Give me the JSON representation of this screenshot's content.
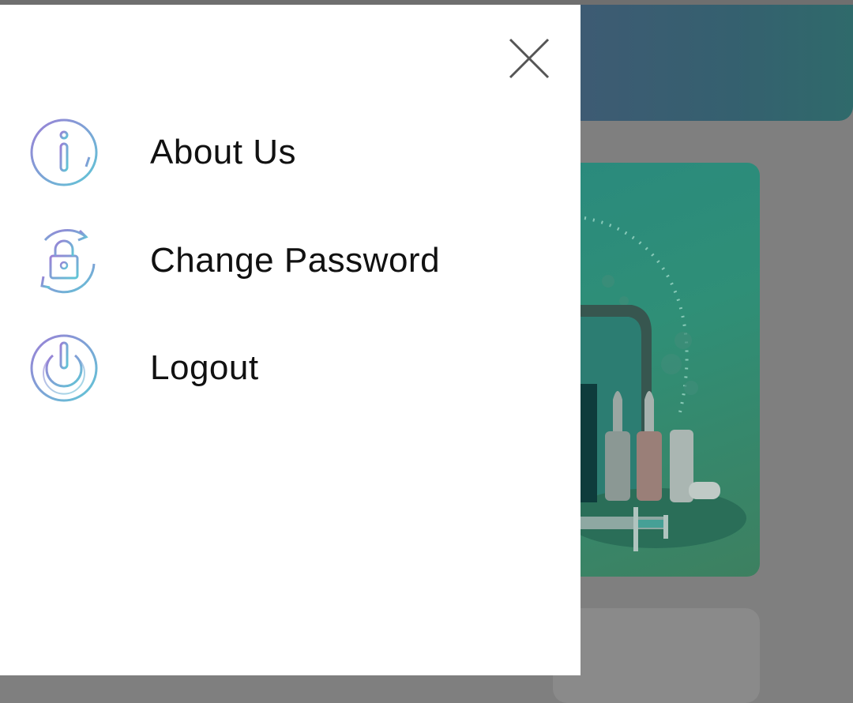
{
  "drawer": {
    "close_icon": "close-icon",
    "items": [
      {
        "label": "About Us",
        "icon": "info-circle-icon"
      },
      {
        "label": "Change Password",
        "icon": "lock-refresh-icon"
      },
      {
        "label": "Logout",
        "icon": "power-icon"
      }
    ]
  },
  "colors": {
    "icon_gradient_start": "#9b7fd6",
    "icon_gradient_end": "#5fc7d6",
    "header_gradient_start": "#3f5a74",
    "header_gradient_end": "#2f6a6b",
    "card_green": "#2f8f77",
    "scrim": "#7f7f7f"
  }
}
